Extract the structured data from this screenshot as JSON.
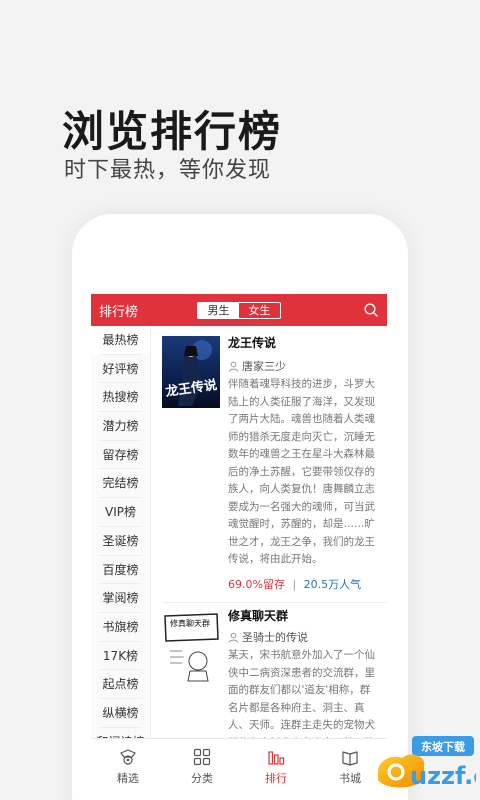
{
  "hero": {
    "title": "浏览排行榜",
    "subtitle": "时下最热，等你发现"
  },
  "header": {
    "title": "排行榜",
    "segments": [
      "男生",
      "女生"
    ],
    "active_segment": "男生"
  },
  "sidebar": {
    "active": "最热榜",
    "items": [
      "最热榜",
      "好评榜",
      "热搜榜",
      "潜力榜",
      "留存榜",
      "完结榜",
      "VIP榜",
      "圣诞榜",
      "百度榜",
      "掌阅榜",
      "书旗榜",
      "17K榜",
      "起点榜",
      "纵横榜",
      "和阅读榜"
    ]
  },
  "books": [
    {
      "title": "龙王传说",
      "author": "唐家三少",
      "description": "伴随着魂导科技的进步，斗罗大陆上的人类征服了海洋，又发现了两片大陆。魂兽也随着人类魂师的猎杀无度走向灭亡，沉睡无数年的魂兽之王在星斗大森林最后的净土苏醒，它要带领仅存的族人，向人类复仇！唐舞麟立志要成为一名强大的魂师，可当武魂觉醒时，苏醒的，却是……旷世之才，龙王之争，我们的龙王传说，将由此开始。",
      "retention": "69.0%留存",
      "separator": "|",
      "popularity": "20.5万人气",
      "cover_text": "龙王传说"
    },
    {
      "title": "修真聊天群",
      "author": "圣骑士的传说",
      "description": "某天，宋书航意外加入了一个仙侠中二病资深患者的交流群，里面的群友们都以'道友'相称，群名片都是各种府主、洞主、真人、天师。连群主走失的宠物犬都称为大妖犬离家出走。整天聊的是炼丹、闯秘境、炼功经验啥的。突然有一天，潜水良久的他突然发现……群",
      "cover_text": "修真聊天群"
    }
  ],
  "tabbar": {
    "active": "排行",
    "items": [
      {
        "label": "精选",
        "icon": "medal-icon"
      },
      {
        "label": "分类",
        "icon": "grid-icon"
      },
      {
        "label": "排行",
        "icon": "bar-chart-icon"
      },
      {
        "label": "书城",
        "icon": "bookstore-icon"
      }
    ]
  },
  "watermark": {
    "text1": "东坡下载",
    "text2": "uzzf.com"
  },
  "colors": {
    "accent": "#e0323a",
    "blue": "#2b6fc0"
  }
}
